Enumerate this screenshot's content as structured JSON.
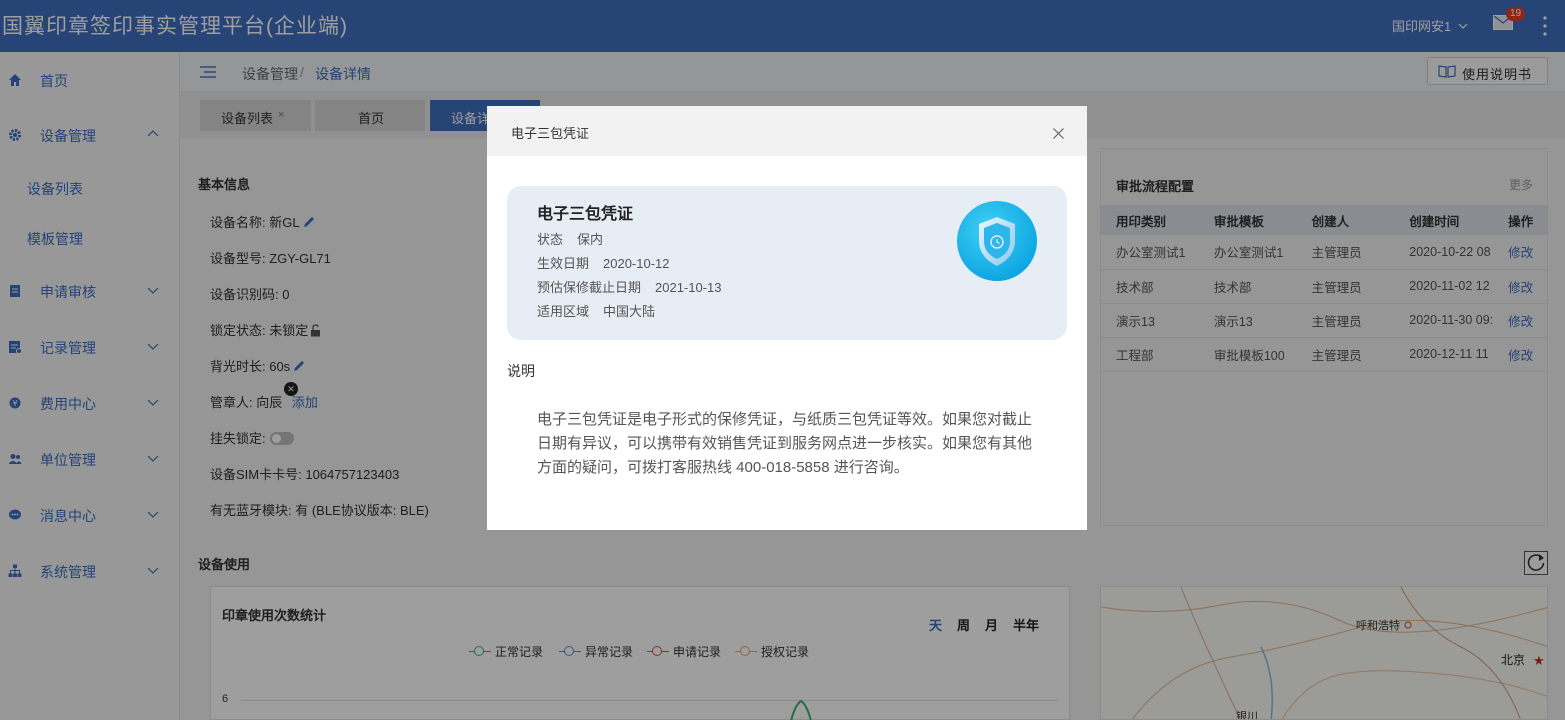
{
  "header": {
    "app_title": "国翼印章签印事实管理平台(企业端)",
    "user_name": "国印网安1",
    "mail_badge": "19"
  },
  "sidebar": {
    "items": [
      {
        "label": "首页",
        "icon": "home-icon"
      },
      {
        "label": "设备管理",
        "icon": "gear-icon",
        "expanded": true
      },
      {
        "label": "设备列表"
      },
      {
        "label": "模板管理"
      },
      {
        "label": "申请审核",
        "icon": "document-icon"
      },
      {
        "label": "记录管理",
        "icon": "record-icon"
      },
      {
        "label": "费用中心",
        "icon": "coin-icon"
      },
      {
        "label": "单位管理",
        "icon": "users-icon"
      },
      {
        "label": "消息中心",
        "icon": "chat-icon"
      },
      {
        "label": "系统管理",
        "icon": "org-chart-icon"
      }
    ]
  },
  "breadcrumb": {
    "parent": "设备管理",
    "separator": "/",
    "current": "设备详情"
  },
  "manual_button": "使用说明书",
  "tabs": [
    {
      "label": "设备列表",
      "close": "×"
    },
    {
      "label": "首页"
    },
    {
      "label": "设备详情",
      "active": true
    }
  ],
  "basic_info": {
    "title": "基本信息",
    "device_name": "设备名称:  新GL",
    "device_model": "设备型号:  ZGY-GL71",
    "device_id": "设备识别码:  0",
    "lock_status": "锁定状态:  未锁定",
    "backlight": "背光时长:  60s",
    "keeper_label": "管章人:  向辰",
    "keeper_add": "添加",
    "loss_lock": "挂失锁定:",
    "sim": "设备SIM卡卡号:  1064757123403",
    "bluetooth": "有无蓝牙模块:  有 (BLE协议版本:  BLE)"
  },
  "approval": {
    "title": "审批流程配置",
    "more": "更多",
    "headers": [
      "用印类别",
      "审批模板",
      "创建人",
      "创建时间",
      "操作"
    ],
    "rows": [
      [
        "办公室测试1",
        "办公室测试1",
        "主管理员",
        "2020-10-22 08",
        "修改"
      ],
      [
        "技术部",
        "技术部",
        "主管理员",
        "2020-11-02 12",
        "修改"
      ],
      [
        "演示13",
        "演示13",
        "主管理员",
        "2020-11-30 09:",
        "修改"
      ],
      [
        "工程部",
        "审批模板100",
        "主管理员",
        "2020-12-11 11",
        "修改"
      ]
    ]
  },
  "usage": {
    "title": "设备使用",
    "chart_title": "印章使用次数统计",
    "periods": [
      "天",
      "周",
      "月",
      "半年"
    ],
    "active_period": "天",
    "legend": [
      {
        "name": "正常记录",
        "color": "#3cb371"
      },
      {
        "name": "异常记录",
        "color": "#5b8fd6"
      },
      {
        "name": "申请记录",
        "color": "#d9534f"
      },
      {
        "name": "授权记录",
        "color": "#f0a070"
      }
    ],
    "y_tick": "6"
  },
  "map": {
    "labels": [
      "呼和浩特",
      "北京",
      "银川"
    ]
  },
  "modal": {
    "title": "电子三包凭证",
    "card_title": "电子三包凭证",
    "status_label": "状态",
    "status_value": "保内",
    "effective_label": "生效日期",
    "effective_value": "2020-10-12",
    "expire_label": "预估保修截止日期",
    "expire_value": "2021-10-13",
    "region_label": "适用区域",
    "region_value": "中国大陆",
    "note_title": "说明",
    "note_body": "电子三包凭证是电子形式的保修凭证，与纸质三包凭证等效。如果您对截止日期有异议，可以携带有效销售凭证到服务网点进一步核实。如果您有其他方面的疑问，可拨打客服热线 400-018-5858 进行咨询。"
  },
  "colors": {
    "header_bg": "#3f6fbf",
    "accent": "#3b6cc0",
    "card_bg": "#e7edf5",
    "badge": "#e6402b"
  }
}
